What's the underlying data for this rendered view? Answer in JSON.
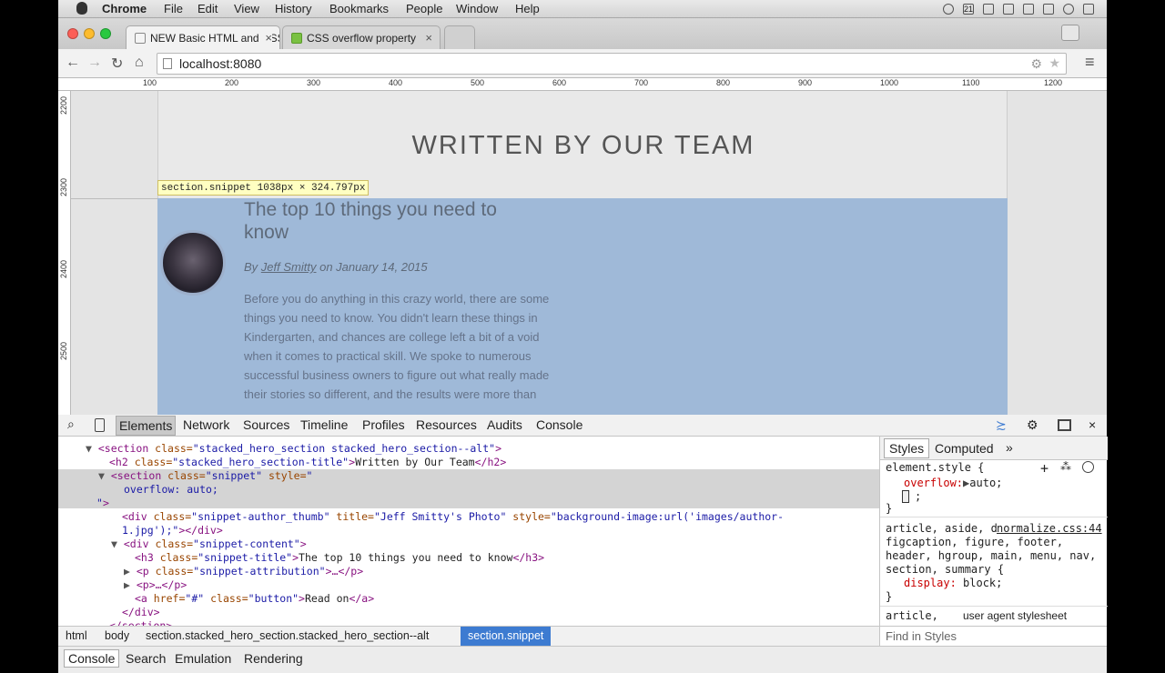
{
  "menubar": {
    "app": "Chrome",
    "items": [
      "File",
      "Edit",
      "View",
      "History",
      "Bookmarks",
      "People",
      "Window",
      "Help"
    ],
    "badge": "21"
  },
  "tabs": [
    {
      "title": "NEW Basic HTML and CSS"
    },
    {
      "title": "CSS overflow property"
    }
  ],
  "toolbar": {
    "url": "localhost:8080"
  },
  "ruler": {
    "h": [
      "100",
      "200",
      "300",
      "400",
      "500",
      "600",
      "700",
      "800",
      "900",
      "1000",
      "1100",
      "1200"
    ],
    "v": [
      "2200",
      "2300",
      "2400",
      "2500"
    ]
  },
  "page": {
    "hero_title": "WRITTEN BY OUR TEAM",
    "tooltip": "section.snippet 1038px × 324.797px",
    "snippet_title": "The top 10 things you need to know",
    "attr_by": "By ",
    "attr_author": "Jeff Smitty",
    "attr_date": " on January 14, 2015",
    "body": "Before you do anything in this crazy world, there are some things you need to know. You didn't learn these things in Kindergarten, and chances are college left a bit of a void when it comes to practical skill. We spoke to numerous successful business owners to figure out what really made their stories so different, and the results were more than"
  },
  "devtools": {
    "tabs": [
      "Elements",
      "Network",
      "Sources",
      "Timeline",
      "Profiles",
      "Resources",
      "Audits",
      "Console"
    ],
    "styles_tabs": [
      "Styles",
      "Computed"
    ],
    "dom": [
      {
        "tag": "<section ",
        "attr": "class=",
        "val": "\"stacked_hero_section stacked_hero_section--alt\"",
        "end": ">"
      },
      {
        "tag": "<h2 ",
        "attr": "class=",
        "val": "\"stacked_hero_section-title\"",
        "end": ">",
        "text": "Written by Our Team",
        "close": "</h2>"
      },
      {
        "tag": "<section ",
        "attr": "class=",
        "val": "\"snippet\"",
        "attr2": " style=",
        "val2": "\""
      },
      {
        "text": "overflow: auto;"
      },
      {
        "val": "\"",
        "end": ">"
      },
      {
        "tag": "<div ",
        "attr": "class=",
        "val": "\"snippet-author_thumb\"",
        "attr2": " title=",
        "val2": "\"Jeff Smitty's Photo\"",
        "attr3": " style=",
        "val3": "\"background-image:url('images/author-"
      },
      {
        "val": "1.jpg');\"",
        "end": "></div>"
      },
      {
        "tag": "<div ",
        "attr": "class=",
        "val": "\"snippet-content\"",
        "end": ">"
      },
      {
        "tag": "<h3 ",
        "attr": "class=",
        "val": "\"snippet-title\"",
        "end": ">",
        "text": "The top 10 things you need to know",
        "close": "</h3>"
      },
      {
        "tag": "<p ",
        "attr": "class=",
        "val": "\"snippet-attribution\"",
        "end": ">…</p>"
      },
      {
        "tag": "<p>…</p>"
      },
      {
        "tag": "<a ",
        "attr": "href=",
        "val": "\"#\"",
        "attr2": " class=",
        "val2": "\"button\"",
        "end": ">",
        "text": "Read on",
        "close": "</a>"
      },
      {
        "tag": "</div>"
      },
      {
        "tag": "</section>"
      }
    ],
    "styles": {
      "element_style": "element.style {",
      "prop": "overflow:",
      "val": "auto;",
      "rule_selector": "article, aside, details, figcaption, figure, footer, header, hgroup, main, menu, nav, section, summary {",
      "rule_source": "normalize.css:44",
      "rule_prop": "display:",
      "rule_val": "block;",
      "ua_selector": "article,",
      "ua_label": "user agent stylesheet",
      "find": "Find in Styles"
    },
    "breadcrumbs": [
      "html",
      "body",
      "section.stacked_hero_section.stacked_hero_section--alt",
      "section.snippet"
    ],
    "drawer": [
      "Console",
      "Search",
      "Emulation",
      "Rendering"
    ]
  },
  "colors": {
    "highlight": "#9fb9d8",
    "selected_crumb": "#3d7bd1",
    "tag": "#881280",
    "attr": "#994500",
    "value": "#1a1aa6"
  }
}
